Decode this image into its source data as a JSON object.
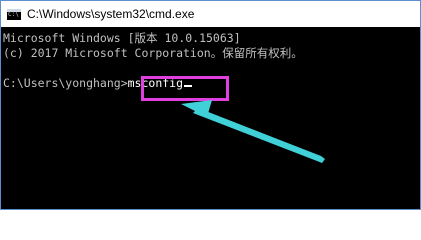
{
  "window": {
    "title": "C:\\Windows\\system32\\cmd.exe",
    "icon_text": "C:\\"
  },
  "console": {
    "line1": "Microsoft Windows [版本 10.0.15063]",
    "line2": "(c) 2017 Microsoft Corporation。保留所有权利。",
    "prompt": "C:\\Users\\yonghang>",
    "command": "msconfig"
  },
  "annotations": {
    "highlight_color": "#e040e0",
    "arrow_color": "#3fd0d8"
  }
}
